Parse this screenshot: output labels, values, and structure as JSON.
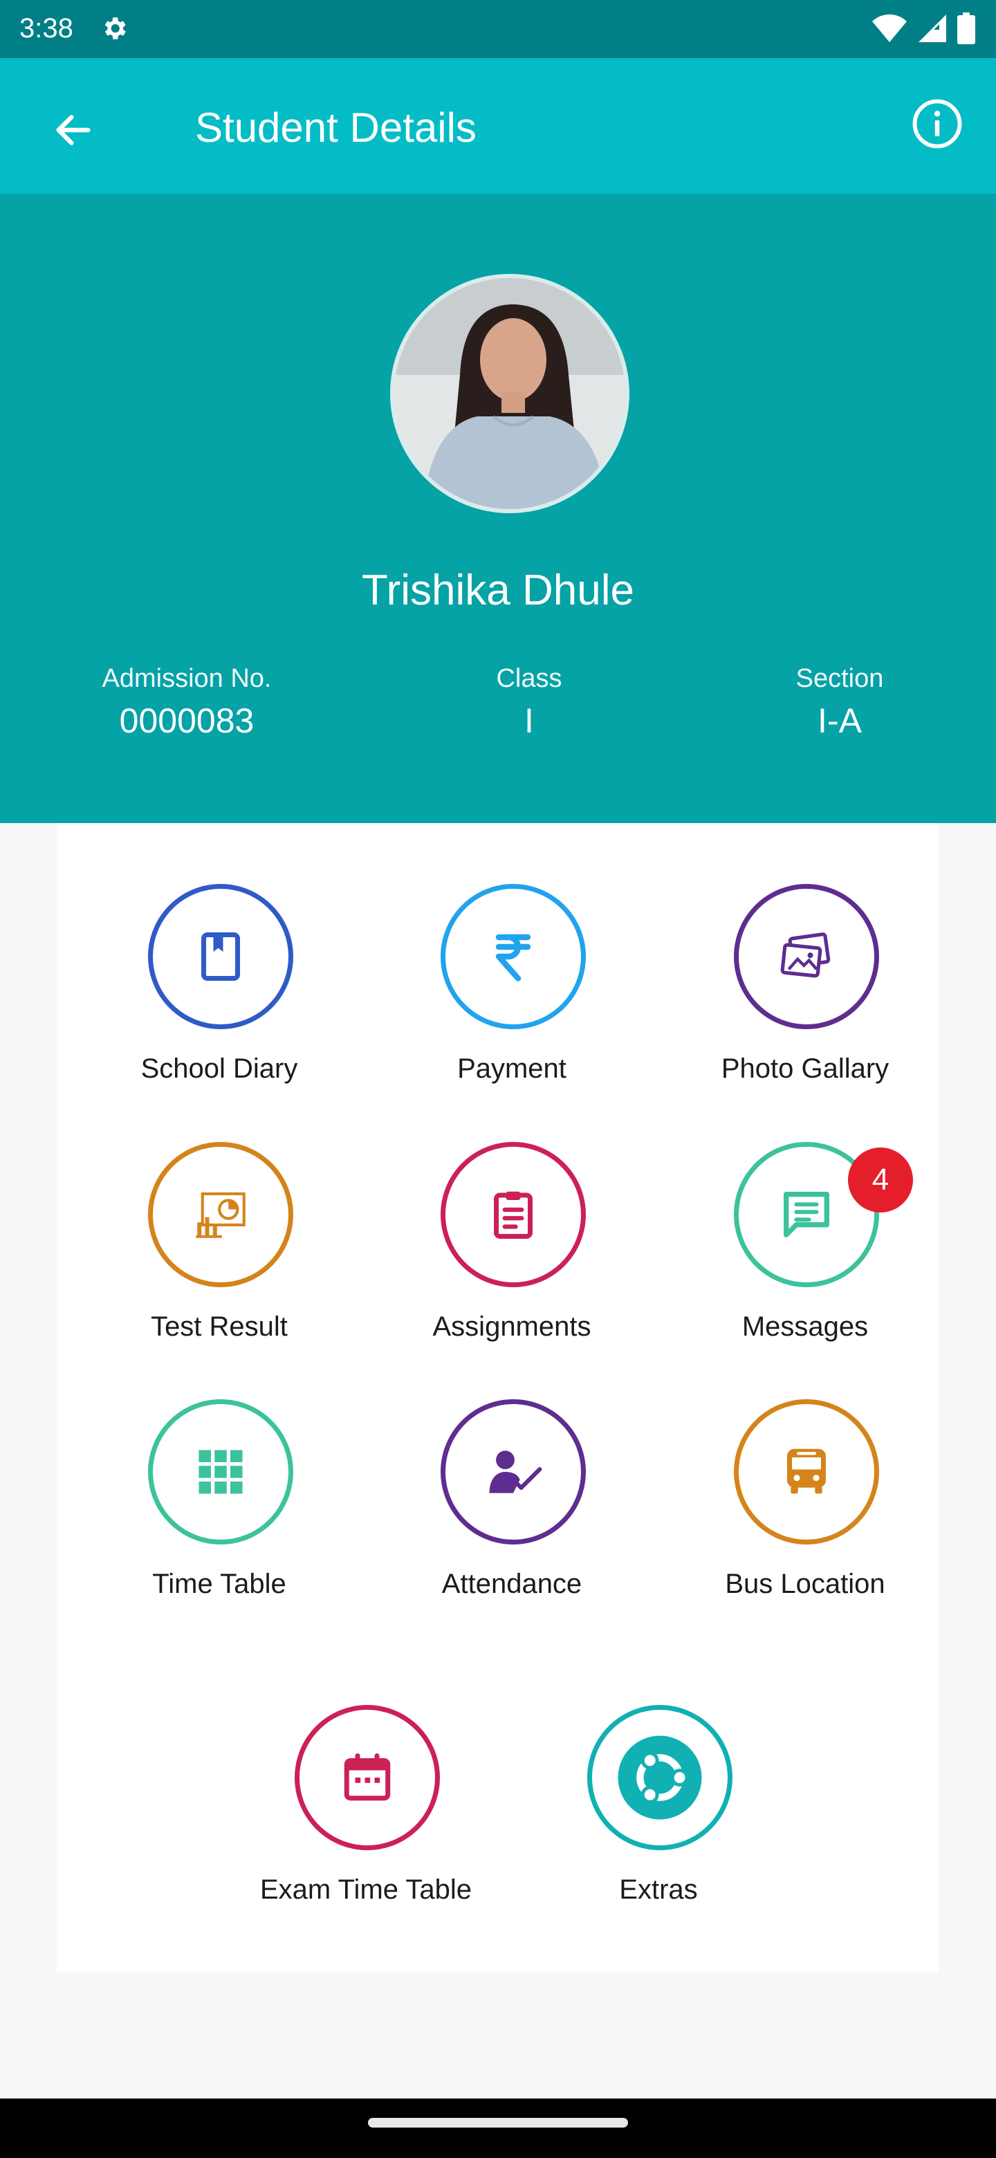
{
  "status_bar": {
    "time": "3:38",
    "icons": [
      "settings-gear-icon",
      "wifi-icon",
      "cell-signal-icon",
      "battery-icon"
    ]
  },
  "app_bar": {
    "title": "Student Details",
    "back_icon": "arrow-left-icon",
    "info_icon": "info-circle-icon"
  },
  "student": {
    "name": "Trishika  Dhule",
    "admission_label": "Admission No.",
    "admission_no": "0000083",
    "class_label": "Class",
    "class_value": "I",
    "section_label": "Section",
    "section_value": "I-A"
  },
  "menu": {
    "items": [
      {
        "label": "School Diary",
        "icon": "book-bookmark-icon",
        "color": "#2f5ac8"
      },
      {
        "label": "Payment",
        "icon": "rupee-icon",
        "color": "#21a3ee"
      },
      {
        "label": "Photo Gallary",
        "icon": "images-icon",
        "color": "#5e2d8f"
      },
      {
        "label": "Test Result",
        "icon": "chart-presentation-icon",
        "color": "#d4841b"
      },
      {
        "label": "Assignments",
        "icon": "clipboard-icon",
        "color": "#cc2155"
      },
      {
        "label": "Messages",
        "icon": "chat-message-icon",
        "color": "#3cc29c",
        "badge": "4"
      },
      {
        "label": "Time Table",
        "icon": "grid-table-icon",
        "color": "#3cc29c"
      },
      {
        "label": "Attendance",
        "icon": "person-check-icon",
        "color": "#5e2d8f"
      },
      {
        "label": "Bus Location",
        "icon": "bus-icon",
        "color": "#d4841b"
      },
      {
        "label": "Exam Time Table",
        "icon": "calendar-icon",
        "color": "#cc2155"
      },
      {
        "label": "Extras",
        "icon": "ubuntu-circle-icon",
        "color": "#10b0b3"
      }
    ]
  },
  "colors": {
    "status_bar": "#007f86",
    "app_bar": "#04bcc6",
    "profile_bg": "#05a2a6",
    "badge": "#e51e2c"
  }
}
